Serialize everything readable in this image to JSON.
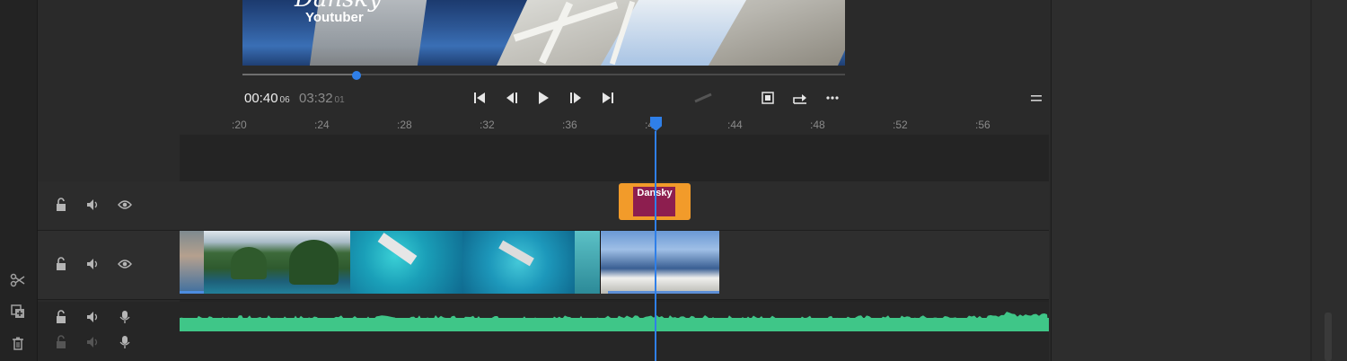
{
  "preview": {
    "title_script": "Dansky",
    "subtitle": "Youtuber"
  },
  "player": {
    "current_time": "00:40",
    "current_frames": "06",
    "duration_time": "03:32",
    "duration_frames": "01",
    "progress": 0.19
  },
  "controls": {
    "icons": [
      "skip-to-start-icon",
      "step-back-icon",
      "play-icon",
      "step-forward-icon",
      "skip-to-end-icon",
      "fit-screen-icon",
      "export-icon",
      "more-icon",
      "menu-icon"
    ]
  },
  "ruler": {
    "ticks": [
      ":20",
      ":24",
      ":28",
      ":32",
      ":36",
      ":40",
      ":44",
      ":48",
      ":52",
      ":56"
    ]
  },
  "timeline": {
    "title_clip_label": "Dansky",
    "colors": {
      "playhead": "#2f7fe8",
      "title_clip": "#f29b2a",
      "title_clip_inner": "#8d1e4f",
      "audio_wave": "#3fc688"
    }
  },
  "left_tools": [
    "scissors-icon",
    "duplicate-icon",
    "trash-icon"
  ]
}
